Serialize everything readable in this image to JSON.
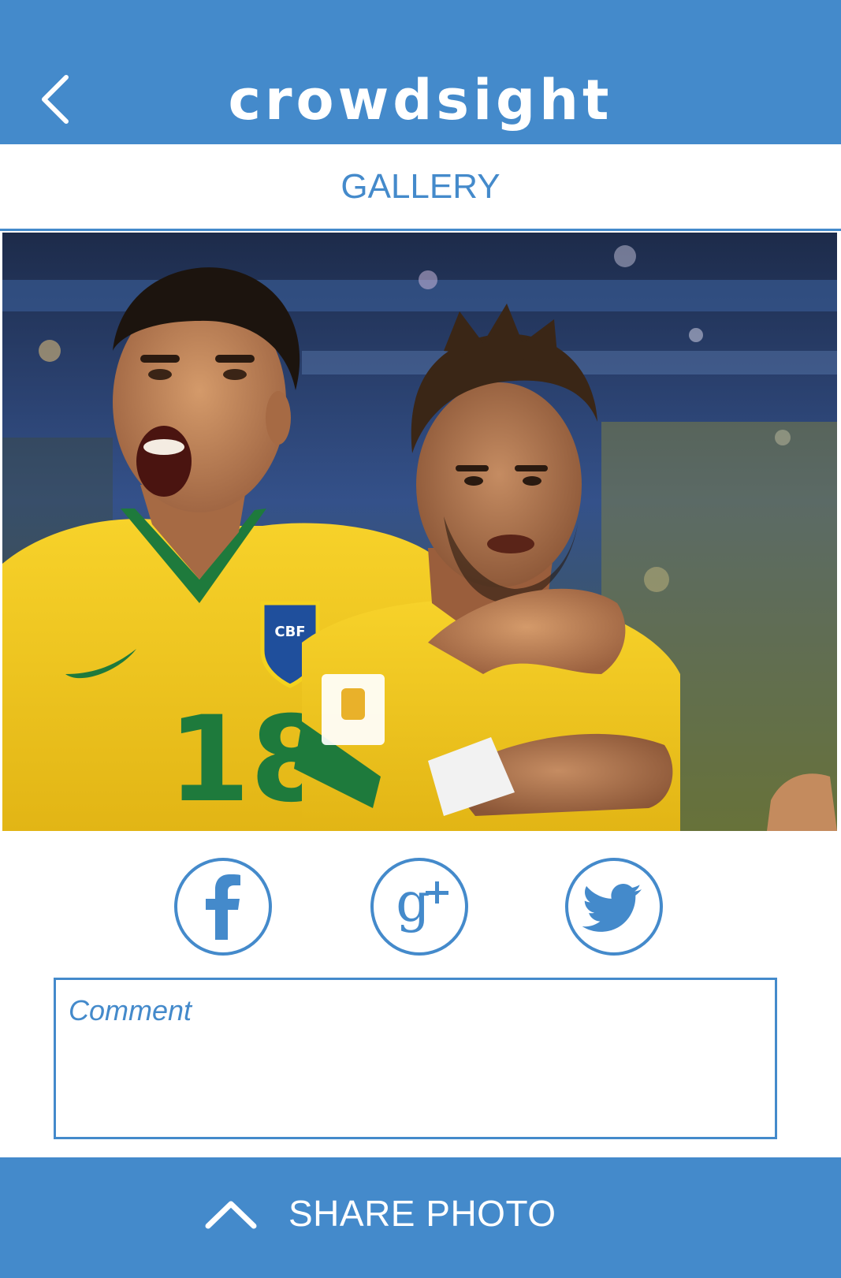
{
  "app": {
    "title": "crowdsight",
    "accent_color": "#448acb",
    "back_icon": "chevron-left-icon"
  },
  "section": {
    "title": "GALLERY"
  },
  "photo": {
    "description_icon": "photo-image",
    "jersey_number": "18"
  },
  "social": {
    "items": [
      {
        "icon": "facebook-icon",
        "glyph": "f"
      },
      {
        "icon": "google-plus-icon",
        "glyph": "g+"
      },
      {
        "icon": "twitter-icon",
        "glyph": "bird"
      }
    ]
  },
  "comment": {
    "placeholder": "Comment",
    "value": ""
  },
  "share": {
    "label": "SHARE PHOTO",
    "icon": "chevron-up-icon"
  }
}
